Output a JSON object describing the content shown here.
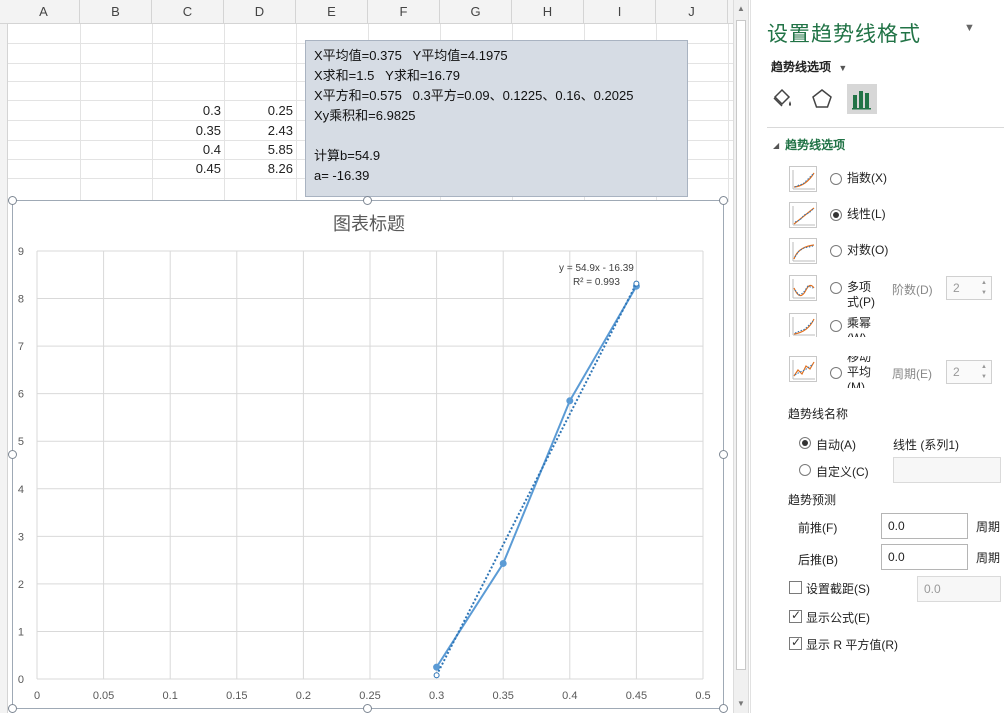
{
  "sheet": {
    "columns": [
      "A",
      "B",
      "C",
      "D",
      "E",
      "F",
      "G",
      "H",
      "I",
      "J"
    ],
    "rows": [
      {
        "c": "0.3",
        "d": "0.25"
      },
      {
        "c": "0.35",
        "d": "2.43"
      },
      {
        "c": "0.4",
        "d": "5.85"
      },
      {
        "c": "0.45",
        "d": "8.26"
      }
    ]
  },
  "textbox": {
    "lines": [
      "X平均值=0.375   Y平均值=4.1975",
      "X求和=1.5   Y求和=16.79",
      "X平方和=0.575   0.3平方=0.09、0.1225、0.16、0.2025",
      "Xy乘积和=6.9825",
      "",
      "计算b=54.9",
      "a= -16.39"
    ]
  },
  "chart_data": {
    "type": "scatter",
    "title": "图表标题",
    "xlim": [
      0,
      0.5
    ],
    "ylim": [
      0,
      9
    ],
    "x_ticks": [
      "0",
      "0.05",
      "0.1",
      "0.15",
      "0.2",
      "0.25",
      "0.3",
      "0.35",
      "0.4",
      "0.45",
      "0.5"
    ],
    "y_ticks": [
      "0",
      "1",
      "2",
      "3",
      "4",
      "5",
      "6",
      "7",
      "8",
      "9"
    ],
    "grid": true,
    "series": [
      {
        "x": [
          0.3,
          0.35,
          0.4,
          0.45
        ],
        "y": [
          0.25,
          2.43,
          5.85,
          8.26
        ],
        "color": "#5b9bd5"
      }
    ],
    "trendline": {
      "type": "linear",
      "slope": 54.9,
      "intercept": -16.39,
      "x_range": [
        0.3,
        0.45
      ],
      "style": "dotted",
      "color": "#2e75b6"
    },
    "annotations": {
      "equation": "y = 54.9x - 16.39",
      "r_squared": "R² = 0.993"
    }
  },
  "pane": {
    "title": "设置趋势线格式",
    "subtitle": "趋势线选项",
    "section": "趋势线选项",
    "options": [
      {
        "label": "指数(X)",
        "selected": false
      },
      {
        "label": "线性(L)",
        "selected": true
      },
      {
        "label": "对数(O)",
        "selected": false
      },
      {
        "label": "多项式(P)",
        "selected": false
      },
      {
        "label": "乘幂(W)",
        "selected": false
      },
      {
        "label": "移动平均(M)",
        "selected": false
      }
    ],
    "order_label": "阶数(D)",
    "order_value": "2",
    "period_label": "周期(E)",
    "period_value": "2",
    "name_section": "趋势线名称",
    "auto_label": "自动(A)",
    "auto_value": "线性 (系列1)",
    "custom_label": "自定义(C)",
    "forecast_section": "趋势预测",
    "forward_label": "前推(F)",
    "forward_value": "0.0",
    "forward_unit": "周期",
    "backward_label": "后推(B)",
    "backward_value": "0.0",
    "backward_unit": "周期",
    "intercept_label": "设置截距(S)",
    "intercept_value": "0.0",
    "show_equation_label": "显示公式(E)",
    "show_r2_label": "显示 R 平方值(R)"
  }
}
